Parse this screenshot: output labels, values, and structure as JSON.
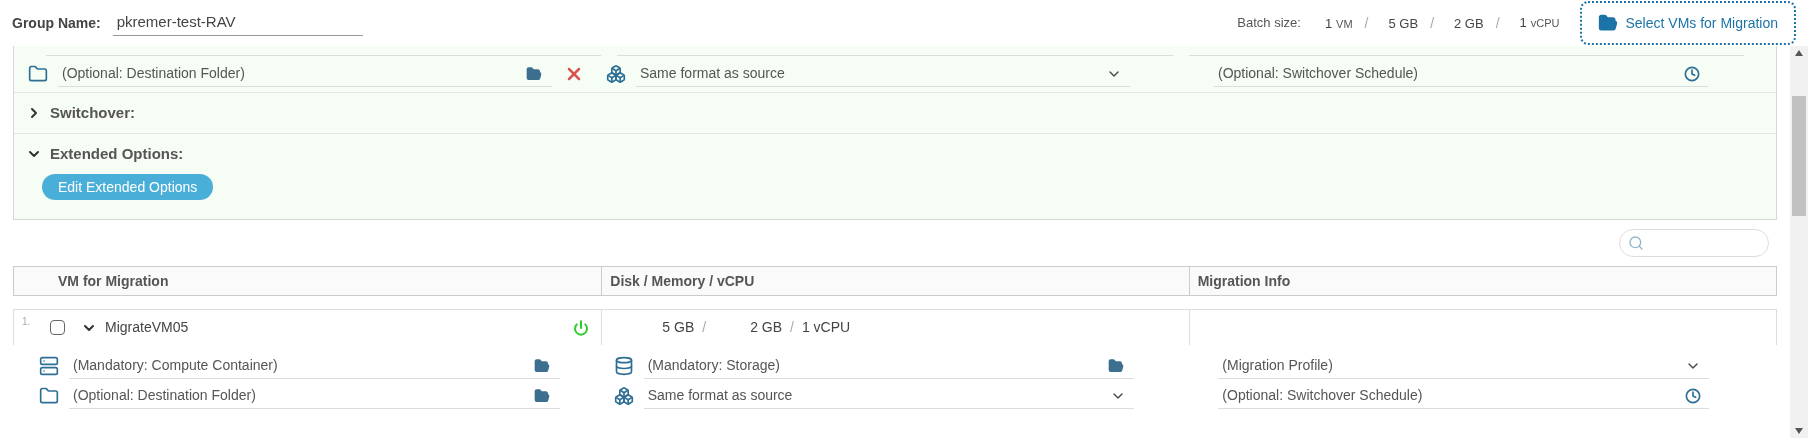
{
  "group_name": {
    "label": "Group Name:",
    "value": "pkremer-test-RAV"
  },
  "batch": {
    "label": "Batch size:",
    "items": [
      {
        "value": "1",
        "unit": "VM",
        "separator": "/"
      },
      {
        "value": "5 GB",
        "separator": "/"
      },
      {
        "value": "2 GB",
        "separator": "/"
      },
      {
        "value": "1",
        "unit": "vCPU"
      }
    ]
  },
  "select_button": "Select VMs for Migration",
  "config_panel": {
    "fields": [
      {
        "kind": "folder",
        "text": "(Optional: Destination Folder)",
        "removable": true
      },
      {
        "kind": "format",
        "text": "Same format as source"
      },
      {
        "kind": "schedule",
        "text": "(Optional: Switchover Schedule)"
      }
    ],
    "sections": [
      {
        "title": "Switchover:",
        "expanded": false
      },
      {
        "title": "Extended Options:",
        "expanded": true,
        "button": "Edit Extended Options"
      }
    ]
  },
  "table": {
    "columns": [
      "VM for Migration",
      "Disk / Memory / vCPU",
      "Migration Info"
    ],
    "rows": [
      {
        "index": "1.",
        "checked": false,
        "expanded": true,
        "name": "MigrateVM05",
        "powered_on": true,
        "disk": "5 GB",
        "memory": "2 GB",
        "vcpu": "1 vCPU",
        "separator": "/",
        "fields": [
          {
            "kind": "compute",
            "text": "(Mandatory: Compute Container)"
          },
          {
            "kind": "storage",
            "text": "(Mandatory: Storage)"
          },
          {
            "kind": "profile",
            "text": "(Migration Profile)"
          },
          {
            "kind": "folder",
            "text": "(Optional: Destination Folder)"
          },
          {
            "kind": "format",
            "text": "Same format as source"
          },
          {
            "kind": "schedule",
            "text": "(Optional: Switchover Schedule)"
          }
        ]
      }
    ]
  }
}
